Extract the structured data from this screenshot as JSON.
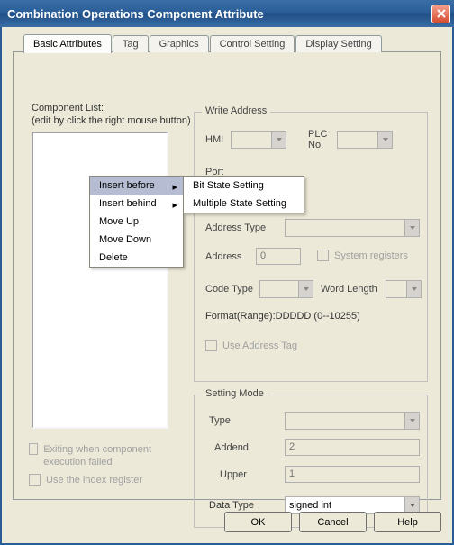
{
  "title": "Combination Operations Component Attribute",
  "tabs": [
    "Basic Attributes",
    "Tag",
    "Graphics",
    "Control Setting",
    "Display Setting"
  ],
  "componentList": {
    "label": "Component List:",
    "hint": "(edit by click the right mouse button)"
  },
  "contextMenu": {
    "items": [
      "Insert before",
      "Insert behind",
      "Move Up",
      "Move Down",
      "Delete"
    ],
    "submenu": [
      "Bit State Setting",
      "Multiple State Setting"
    ]
  },
  "writeAddress": {
    "legend": "Write Address",
    "hmi": "HMI",
    "plc": "PLC\nNo.",
    "port": "Port",
    "addrType": "Address Type",
    "address": "Address",
    "addressVal": "0",
    "sysreg": "System registers",
    "codeType": "Code Type",
    "wordLen": "Word Length",
    "format": "Format(Range):DDDDD (0--10255)",
    "useTag": "Use Address Tag"
  },
  "settingMode": {
    "legend": "Setting Mode",
    "type": "Type",
    "addend": "Addend",
    "addendVal": "2",
    "upper": "Upper",
    "upperVal": "1",
    "dataType": "Data Type",
    "dataTypeVal": "signed int"
  },
  "bottomChecks": {
    "exitFail": "Exiting when component execution failed",
    "useIndex": "Use the index register"
  },
  "buttons": {
    "ok": "OK",
    "cancel": "Cancel",
    "help": "Help"
  }
}
